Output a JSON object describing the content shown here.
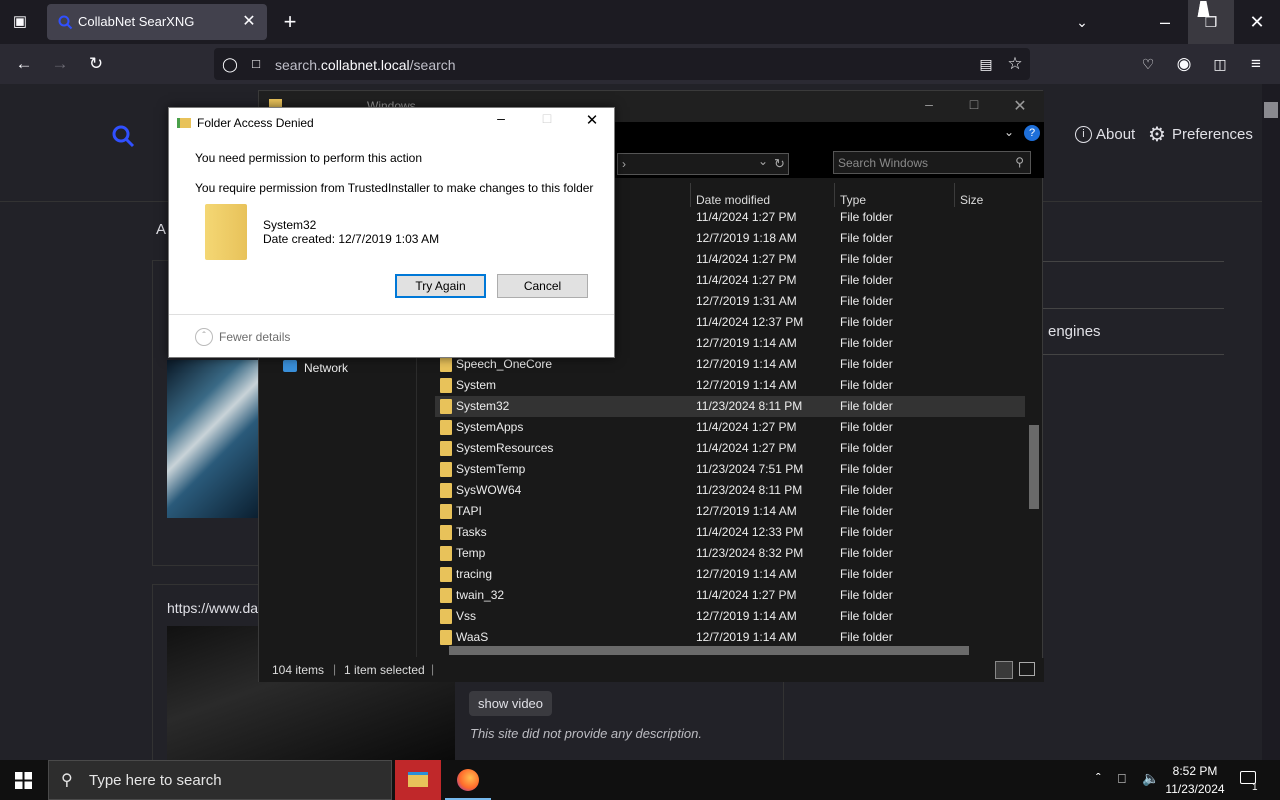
{
  "browser": {
    "tab_title": "CollabNet SearXNG",
    "url_prefix": "search.",
    "url_domain": "collabnet.local",
    "url_path": "/search",
    "new_tab_label": "+"
  },
  "page": {
    "about_label": "About",
    "preferences_label": "Preferences",
    "engines_fragment": "engines",
    "result_url_fragment": "https://www.da",
    "partial_a": "A",
    "show_video_label": "show video",
    "no_description": "This site did not provide any description."
  },
  "explorer": {
    "title": "Windows",
    "search_placeholder": "Search Windows",
    "columns": {
      "date": "Date modified",
      "type": "Type",
      "size": "Size"
    },
    "nav": {
      "network": "Network"
    },
    "rows": [
      {
        "name": "",
        "date": "11/4/2024 1:27 PM",
        "type": "File folder"
      },
      {
        "name": "",
        "date": "12/7/2019 1:18 AM",
        "type": "File folder"
      },
      {
        "name": "",
        "date": "11/4/2024 1:27 PM",
        "type": "File folder"
      },
      {
        "name": "",
        "date": "11/4/2024 1:27 PM",
        "type": "File folder"
      },
      {
        "name": "",
        "date": "12/7/2019 1:31 AM",
        "type": "File folder"
      },
      {
        "name": "",
        "date": "11/4/2024 12:37 PM",
        "type": "File folder"
      },
      {
        "name": "",
        "date": "12/7/2019 1:14 AM",
        "type": "File folder"
      },
      {
        "name": "Speech_OneCore",
        "date": "12/7/2019 1:14 AM",
        "type": "File folder"
      },
      {
        "name": "System",
        "date": "12/7/2019 1:14 AM",
        "type": "File folder"
      },
      {
        "name": "System32",
        "date": "11/23/2024 8:11 PM",
        "type": "File folder",
        "selected": true
      },
      {
        "name": "SystemApps",
        "date": "11/4/2024 1:27 PM",
        "type": "File folder"
      },
      {
        "name": "SystemResources",
        "date": "11/4/2024 1:27 PM",
        "type": "File folder"
      },
      {
        "name": "SystemTemp",
        "date": "11/23/2024 7:51 PM",
        "type": "File folder"
      },
      {
        "name": "SysWOW64",
        "date": "11/23/2024 8:11 PM",
        "type": "File folder"
      },
      {
        "name": "TAPI",
        "date": "12/7/2019 1:14 AM",
        "type": "File folder"
      },
      {
        "name": "Tasks",
        "date": "11/4/2024 12:33 PM",
        "type": "File folder"
      },
      {
        "name": "Temp",
        "date": "11/23/2024 8:32 PM",
        "type": "File folder"
      },
      {
        "name": "tracing",
        "date": "12/7/2019 1:14 AM",
        "type": "File folder"
      },
      {
        "name": "twain_32",
        "date": "11/4/2024 1:27 PM",
        "type": "File folder"
      },
      {
        "name": "Vss",
        "date": "12/7/2019 1:14 AM",
        "type": "File folder"
      },
      {
        "name": "WaaS",
        "date": "12/7/2019 1:14 AM",
        "type": "File folder"
      }
    ],
    "status_items": "104 items",
    "status_selected": "1 item selected"
  },
  "dialog": {
    "title": "Folder Access Denied",
    "line1": "You need permission to perform this action",
    "line2": "You require permission from TrustedInstaller to make changes to this folder",
    "item_name": "System32",
    "item_date": "Date created: 12/7/2019 1:03 AM",
    "try_again": "Try Again",
    "cancel": "Cancel",
    "fewer_details": "Fewer details"
  },
  "taskbar": {
    "search_placeholder": "Type here to search",
    "time": "8:52 PM",
    "date": "11/23/2024",
    "notification_count": "1"
  },
  "colors": {
    "accent": "#0078d7",
    "folder": "#e8c25a",
    "searx_blue": "#3050ff"
  }
}
